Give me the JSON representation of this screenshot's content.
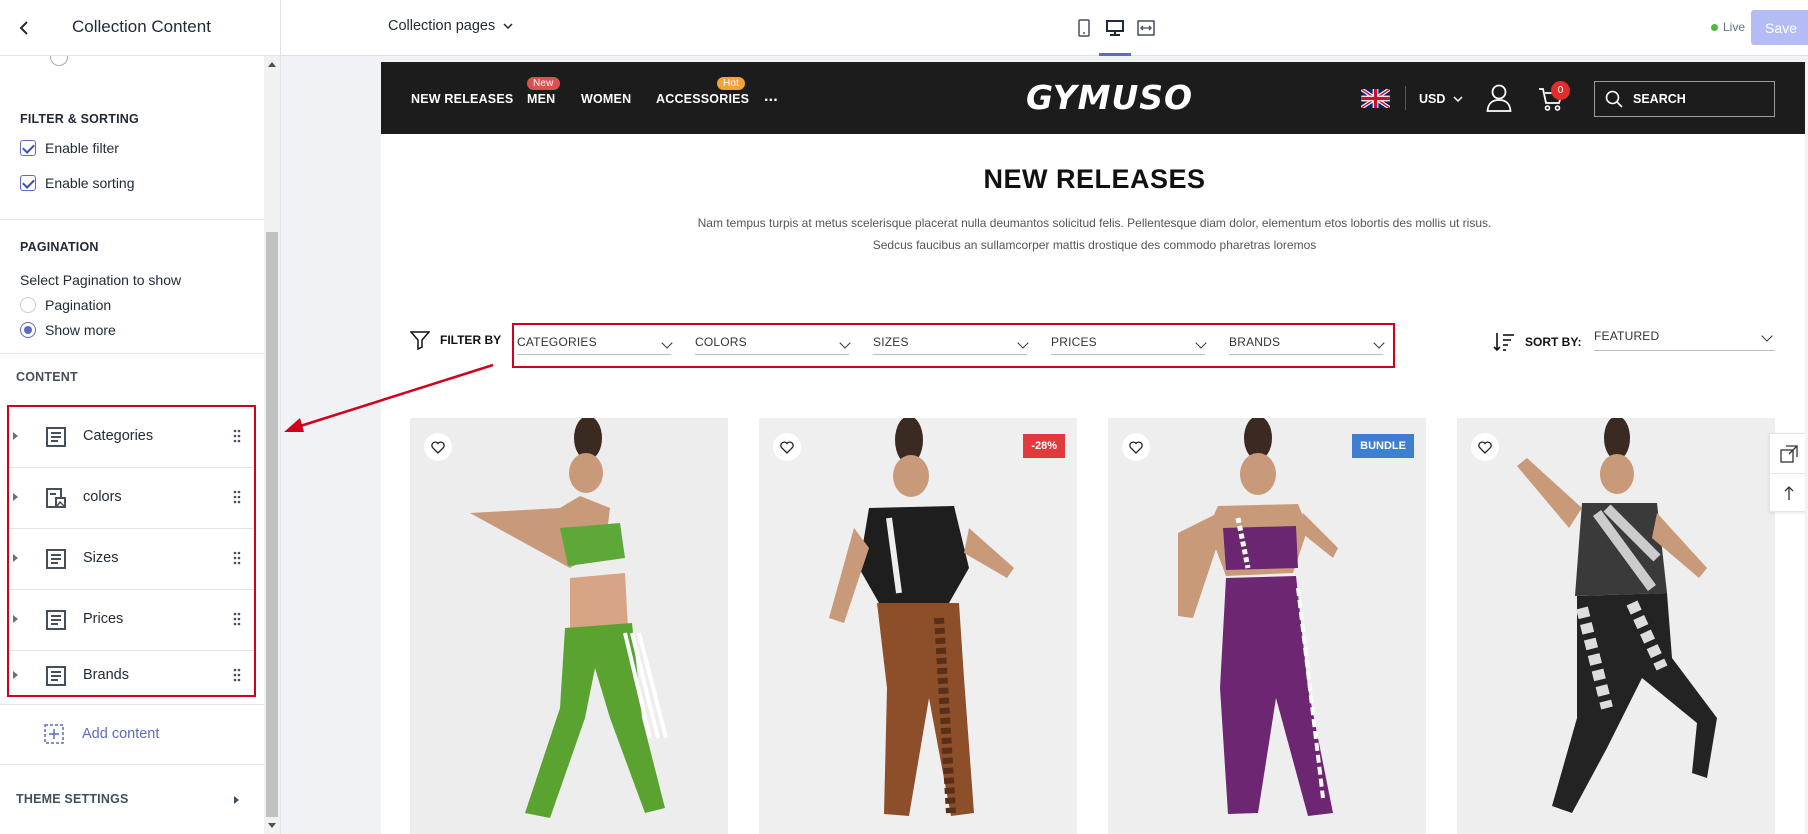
{
  "sidebar": {
    "title": "Collection Content",
    "filter_section": {
      "title": "FILTER & SORTING",
      "enable_filter": "Enable filter",
      "enable_sorting": "Enable sorting"
    },
    "pagination_section": {
      "title": "PAGINATION",
      "select_label": "Select Pagination to show",
      "options": [
        "Pagination",
        "Show more"
      ],
      "selected": "Show more"
    },
    "content_section": {
      "title": "CONTENT",
      "blocks": [
        {
          "label": "Categories",
          "icon": "text-block-icon"
        },
        {
          "label": "colors",
          "icon": "image-text-block-icon"
        },
        {
          "label": "Sizes",
          "icon": "text-block-icon"
        },
        {
          "label": "Prices",
          "icon": "text-block-icon"
        },
        {
          "label": "Brands",
          "icon": "text-block-icon"
        }
      ],
      "add_content": "Add content"
    },
    "theme_settings": "THEME SETTINGS"
  },
  "topbar": {
    "page_select": "Collection pages",
    "devices": [
      "mobile-icon",
      "desktop-icon",
      "fullwidth-icon"
    ],
    "active_device": "desktop-icon",
    "live_label": "Live",
    "save_label": "Save"
  },
  "store": {
    "nav": [
      {
        "label": "NEW RELEASES",
        "badge": ""
      },
      {
        "label": "MEN",
        "badge": "New",
        "badge_color": "#e04f4f"
      },
      {
        "label": "WOMEN",
        "badge": ""
      },
      {
        "label": "ACCESSORIES",
        "badge": "Hot",
        "badge_color": "#f2a23a"
      },
      {
        "label": "...",
        "badge": ""
      }
    ],
    "logo": "GYMUSO",
    "currency": "USD",
    "cart_count": "0",
    "search_placeholder": "SEARCH",
    "collection_title": "NEW RELEASES",
    "description_line1": "Nam tempus turpis at metus scelerisque placerat nulla deumantos solicitud felis. Pellentesque diam dolor, elementum etos lobortis des mollis ut risus.",
    "description_line2": "Sedcus faucibus an sullamcorper mattis drostique des commodo pharetras loremos",
    "filter_label": "FILTER BY",
    "filters": [
      "CATEGORIES",
      "COLORS",
      "SIZES",
      "PRICES",
      "BRANDS"
    ],
    "sort_label": "SORT BY:",
    "sort_value": "FEATURED",
    "products": [
      {
        "badge": "",
        "badge_color": "",
        "outfit": "green"
      },
      {
        "badge": "-28%",
        "badge_color": "#e03a3e",
        "outfit": "brown"
      },
      {
        "badge": "BUNDLE",
        "badge_color": "#3f7fcf",
        "outfit": "purple"
      },
      {
        "badge": "",
        "badge_color": "",
        "outfit": "camo"
      }
    ]
  },
  "colors": {
    "accent": "#5c6ac4",
    "highlight": "#d0021b",
    "store_header": "#1c1c1c"
  }
}
